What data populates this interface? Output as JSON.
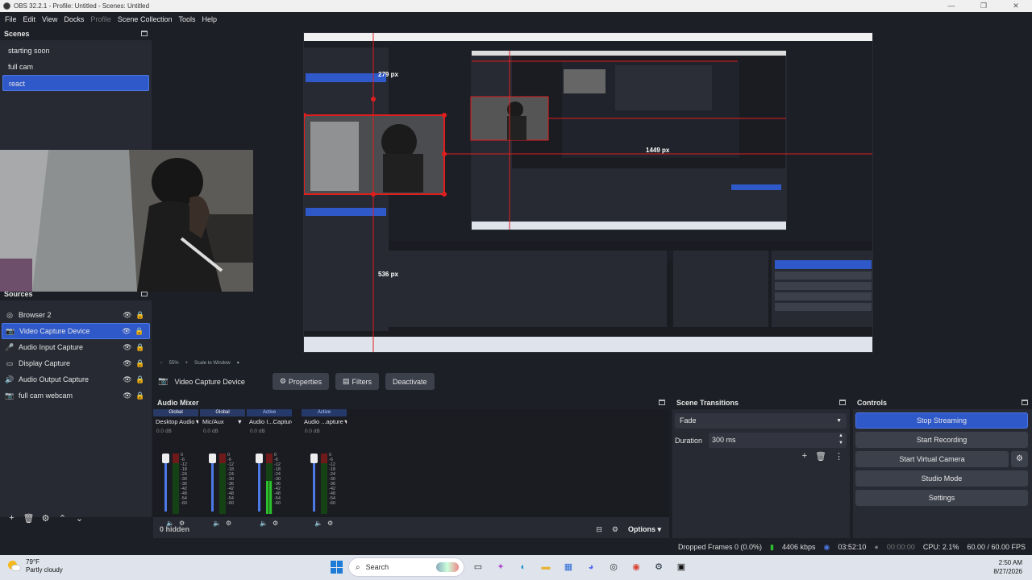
{
  "window": {
    "title": "OBS 32.2.1 - Profile: Untitled - Scenes: Untitled",
    "controls": [
      "—",
      "❐",
      "✕"
    ]
  },
  "menu": [
    "File",
    "Edit",
    "View",
    "Docks",
    "Profile",
    "Scene Collection",
    "Tools",
    "Help"
  ],
  "scenes": {
    "title": "Scenes",
    "items": [
      "starting soon",
      "full cam",
      "react"
    ],
    "selected": "react"
  },
  "sources": {
    "title": "Sources",
    "items": [
      {
        "label": "Browser 2",
        "icon": "globe-icon"
      },
      {
        "label": "Video Capture Device",
        "icon": "camera-icon",
        "selected": true
      },
      {
        "label": "Audio Input Capture",
        "icon": "microphone-icon"
      },
      {
        "label": "Display Capture",
        "icon": "monitor-icon"
      },
      {
        "label": "Audio Output Capture",
        "icon": "speaker-icon"
      },
      {
        "label": "full cam webcam",
        "icon": "camera-icon"
      }
    ]
  },
  "preview": {
    "zoom_label": "55%",
    "scale_label": "Scale to Window",
    "guide_top": "279 px",
    "guide_left": "536 px",
    "guide_right": "1449 px"
  },
  "context": {
    "source_name": "Video Capture Device",
    "properties_label": "Properties",
    "filters_label": "Filters",
    "deactivate_label": "Deactivate"
  },
  "mixer": {
    "title": "Audio Mixer",
    "channels": [
      {
        "tag": "Global",
        "tag_kind": "global",
        "name": "Desktop Audio",
        "db": "0.0 dB",
        "level": 0.0
      },
      {
        "tag": "Global",
        "tag_kind": "global",
        "name": "Mic/Aux",
        "db": "0.0 dB",
        "level": 0.0
      },
      {
        "tag": "Active",
        "tag_kind": "active",
        "name": "Audio I...Capture",
        "db": "0.0 dB",
        "level": 0.55
      },
      {
        "tag": "Active",
        "tag_kind": "active",
        "name": "Audio ...apture",
        "db": "0.0 dB",
        "level": 0.0
      }
    ],
    "scale": [
      "0",
      "-6",
      "-12",
      "-18",
      "-24",
      "-30",
      "-36",
      "-42",
      "-48",
      "-54",
      "-60"
    ],
    "hidden_label": "0 hidden",
    "options_label": "Options ▾"
  },
  "transitions": {
    "title": "Scene Transitions",
    "selected": "Fade",
    "duration_label": "Duration",
    "duration_value": "300 ms"
  },
  "controls": {
    "title": "Controls",
    "stop_streaming": "Stop Streaming",
    "start_recording": "Start Recording",
    "start_virtual_camera": "Start Virtual Camera",
    "studio_mode": "Studio Mode",
    "settings": "Settings"
  },
  "status": {
    "dropped_frames": "Dropped Frames 0 (0.0%)",
    "bitrate": "4406 kbps",
    "stream_time": "03:52:10",
    "record_time": "00:00:00",
    "cpu": "CPU: 2.1%",
    "fps": "60.00 / 60.00 FPS"
  },
  "taskbar": {
    "temperature": "79°F",
    "weather": "Partly cloudy",
    "search_placeholder": "Search",
    "time": "2:50 AM",
    "date": "8/27/2026"
  },
  "colors": {
    "accent": "#2f58c9",
    "panel": "#272a33",
    "background": "#1d1f26",
    "guide": "#e01e1e"
  }
}
